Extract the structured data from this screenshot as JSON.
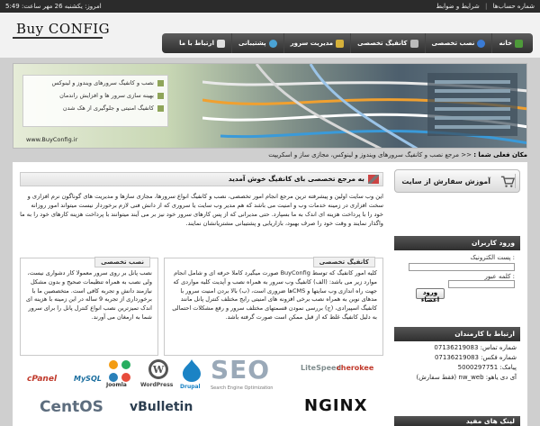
{
  "topbar": {
    "date": "امروز: یکشنبه 26 مهر ساعت: 5:49",
    "links": [
      "شماره حساب‌ها",
      "شرایط و ضوابط"
    ]
  },
  "logo": {
    "text": "Buy CONFIG"
  },
  "nav": [
    {
      "label": "خانه",
      "icon": "home-icon",
      "color": "#4e9a3a"
    },
    {
      "label": "نصب تخصصی",
      "icon": "globe-icon",
      "color": "#3a7bd5"
    },
    {
      "label": "کانفیگ تخصصی",
      "icon": "tools-icon",
      "color": "#bbbbbb"
    },
    {
      "label": "مدیریت سرور",
      "icon": "server-icon",
      "color": "#d6b13a"
    },
    {
      "label": "پشتیبانی",
      "icon": "support-icon",
      "color": "#4aa3d5"
    },
    {
      "label": "ارتباط با ما",
      "icon": "contact-icon",
      "color": "#e0e0e0"
    }
  ],
  "banner": {
    "items": [
      "نصب و کانفیگ سرورهای ویندوز و لینوکس",
      "بهینه سازی سرور ها و افزایش راندمان",
      "کانفیگ امنیتی و جلوگیری از هک شدن"
    ],
    "url": "www.BuyConfig.ir"
  },
  "breadcrumb": {
    "label": "مکان فعلی شما :",
    "path": "<< مرجع نصب و کانفیگ سرورهای ویندوز و لینوکس، مجازی ساز و اسکریپت"
  },
  "sidebar": {
    "order_button": "آموزش سفارش از سایت",
    "login_title": "ورود کاربران",
    "email_label": ": پست الکترونیک",
    "password_label": ": کلمه عبور",
    "login_button": "ورود اعضاء",
    "contact_title": "ارتباط با کارمندان",
    "contact_rows": [
      "شماره تماس: 07136219083",
      "شماره فکس: 07136219083",
      "پیامک: 5000297751",
      "آی دی یاهو: nw_web (فقط سفارش)"
    ],
    "links_title": "لینک های مفید"
  },
  "main": {
    "welcome": "به مرجع تخصصی بای کانفیگ خوش آمدید",
    "intro": "این وب سایت اولین و پیشرفته ترین مرجع انجام امور تخصصی، نصب و کانفیگ انواع سرورها، مجازی سازها و مدیریت های گوناگون نرم افزاری و سخت افزاری در زمینه خدمات وب و امنیت می باشد که هم مدیر وب سایت یا سروری که از دانش فنی لازم برخوردار نیست میتواند امور روزانه خود را با پرداخت هزینه ای اندک به ما بسپارد. حتی مدیرانی که از پس کارهای سرور خود نیز بر می آیند میتوانند با پرداخت هزینه کارهای خود را به ما واگذار نمایند و وقت خود را صرف بهبود، بازاریابی و پشتیبانی مشتریانشان نمایند.",
    "card_config_title": "کانفیگ تخصصی",
    "card_config_text": "کلیه امور کانفیگ که توسط BuyConfig صورت میگیرد کاملا حرفه ای و شامل انجام موارد زیر می باشد: (الف) کانفیگ وب سرور به همراه نصب و آپدیت کلیه مواردی که جهت راه اندازی وب سایتها و CMSها ضروری است، (ب) بالا بردن امنیت سرور با مدهای نوین به همراه نصب برخی افزونه های امنیتی رایج مختلف کنترل پانل مانند کانفیگ اسپیرادی، (ج) بررسی نمودن قسمتهای مختلف سرور و رفع مشکلات احتمالی به دلیل کانفیگ غلط که از قبل ممکن است صورت گرفته باشد.",
    "card_install_title": "نصب تخصصی",
    "card_install_text": "نصب پانل بر روی سرور معمولا کار دشواری نیست، ولی نصب به همراه تنظیمات صحیح و بدون مشکل نیازمند دانش و تجربه کافی است. متخصصین ما با برخورداری از تجربه 9 ساله در این زمینه با هزینه ای اندک تمیزترین نصب انواع کنترل پانل را برای سرور شما به ارمغان می آورند."
  },
  "logos": [
    "cPanel",
    "MySQL",
    "Joomla",
    "WordPress",
    "Drupal",
    "SEO",
    "Search Engine Optimization",
    "LiteSpeed",
    "cherokee",
    "CentOS",
    "vBulletin",
    "NGINX"
  ]
}
